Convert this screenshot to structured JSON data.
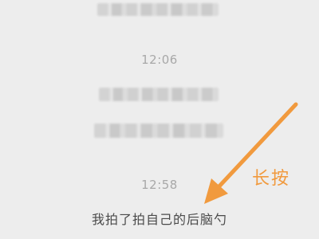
{
  "chat": {
    "timestamps": [
      "12:06",
      "12:58"
    ],
    "system_message": "我拍了拍自己的后脑勺"
  },
  "annotation": {
    "label": "长按",
    "color": "#f19a3e"
  },
  "colors": {
    "background": "#ededed",
    "timestamp_text": "#a8a8a8",
    "message_text": "#4a4a4a"
  }
}
